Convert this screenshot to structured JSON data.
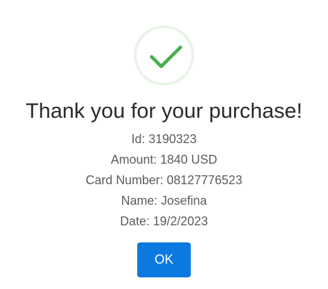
{
  "dialog": {
    "title": "Thank you for your purchase!",
    "details": [
      "Id: 3190323",
      "Amount: 1840 USD",
      "Card Number: 08127776523",
      "Name: Josefina",
      "Date: 19/2/2023"
    ],
    "ok_label": "OK",
    "icon": "checkmark-icon"
  },
  "colors": {
    "check": "#4cae4f",
    "ring": "#e8f4e6",
    "button": "#0a7ae0",
    "title": "#2b2b2b",
    "detail_text": "#5c5c5c"
  }
}
